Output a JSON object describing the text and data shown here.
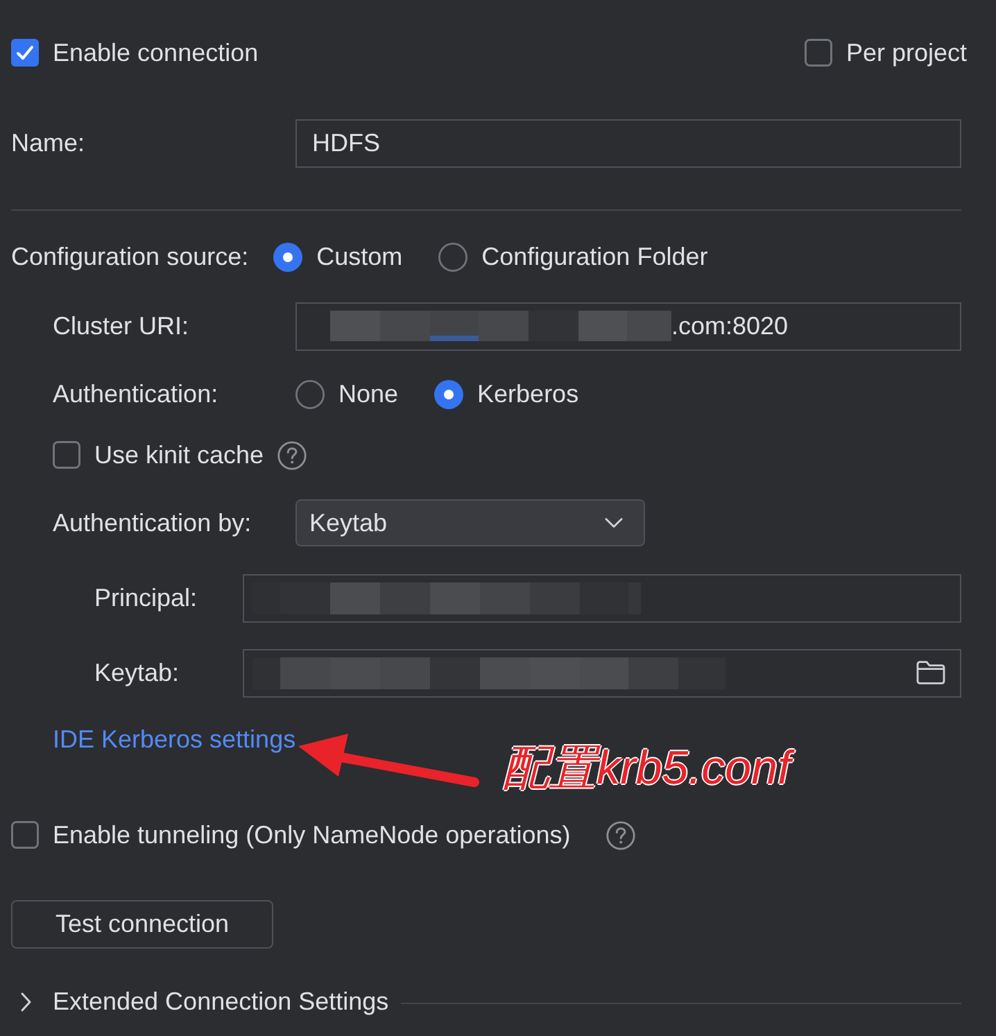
{
  "enable_connection": {
    "label": "Enable connection",
    "checked": true
  },
  "per_project": {
    "label": "Per project",
    "checked": false
  },
  "name": {
    "label": "Name:",
    "value": "HDFS"
  },
  "configuration_source": {
    "label": "Configuration source:",
    "options": [
      {
        "label": "Custom",
        "selected": true
      },
      {
        "label": "Configuration Folder",
        "selected": false
      }
    ]
  },
  "cluster_uri": {
    "label": "Cluster URI:",
    "redacted": true,
    "value": ".com:8020"
  },
  "authentication": {
    "label": "Authentication:",
    "options": [
      {
        "label": "None",
        "selected": false
      },
      {
        "label": "Kerberos",
        "selected": true
      }
    ]
  },
  "use_kinit_cache": {
    "label": "Use kinit cache",
    "checked": false
  },
  "authentication_by": {
    "label": "Authentication by:",
    "value": "Keytab"
  },
  "principal": {
    "label": "Principal:",
    "redacted": true
  },
  "keytab": {
    "label": "Keytab:",
    "redacted": true
  },
  "kerberos_settings_link": "IDE Kerberos settings",
  "annotation": {
    "text": "配置krb5.conf"
  },
  "enable_tunneling": {
    "label": "Enable tunneling (Only NameNode operations)",
    "checked": false
  },
  "test_button": "Test connection",
  "extended_settings": {
    "label": "Extended Connection Settings",
    "expanded": false
  }
}
